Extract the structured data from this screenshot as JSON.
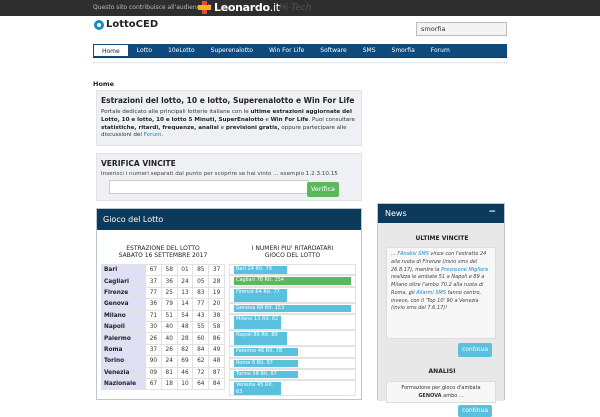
{
  "topbar": {
    "note": "Questo sito contribuisce all'audience di",
    "leo_name": "Leonardo",
    "leo_tld": ".it",
    "leo_sub": "Hi-Tech"
  },
  "site": {
    "name": "LottoCED"
  },
  "search": {
    "value": "smorfia"
  },
  "nav": {
    "items": [
      "Home",
      "Lotto",
      "10eLotto",
      "Superenalotto",
      "Win For Life",
      "Software",
      "SMS",
      "Smorfia",
      "Forum"
    ],
    "active": "Home"
  },
  "breadcrumb": "Home",
  "intro": {
    "title": "Estrazioni del lotto, 10 e lotto, Superenalotto e Win For Life",
    "t1": "Portale dedicato alle principali lotterie italiane con le ",
    "b1": "ultime estrazioni aggiornate del Lotto, 10 e lotto, 10 e lotto 5 Minuti, SuperEnalotto",
    "t2": " e ",
    "b2": "Win For Life",
    "t3": ". Puoi consultare ",
    "b3": "statistiche, ritardi, frequenze, analisi",
    "t4": " e ",
    "b4": "previsioni gratis,",
    "t5": " oppure partecipare alle discussioni del ",
    "link": "Forum",
    "t6": "."
  },
  "verify": {
    "title": "VERIFICA VINCITE",
    "sub": "Inserisci i numeri separati dal punto per scoprire se hai vinto ... esempio 1.2.3.10.15",
    "button": "Verifica"
  },
  "lotto": {
    "title": "Gioco del Lotto",
    "estr_title_1": "ESTRAZIONE DEL LOTTO",
    "estr_title_2": "SABATO 16 SETTEMBRE 2017",
    "rows": [
      {
        "city": "Bari",
        "n": [
          "67",
          "58",
          "01",
          "85",
          "37"
        ]
      },
      {
        "city": "Cagliari",
        "n": [
          "37",
          "36",
          "24",
          "05",
          "28"
        ]
      },
      {
        "city": "Firenze",
        "n": [
          "77",
          "25",
          "13",
          "83",
          "19"
        ]
      },
      {
        "city": "Genova",
        "n": [
          "36",
          "79",
          "14",
          "77",
          "20"
        ]
      },
      {
        "city": "Milano",
        "n": [
          "71",
          "51",
          "54",
          "43",
          "38"
        ]
      },
      {
        "city": "Napoli",
        "n": [
          "30",
          "40",
          "48",
          "55",
          "58"
        ]
      },
      {
        "city": "Palermo",
        "n": [
          "26",
          "40",
          "28",
          "60",
          "86"
        ]
      },
      {
        "city": "Roma",
        "n": [
          "37",
          "26",
          "82",
          "84",
          "49"
        ]
      },
      {
        "city": "Torino",
        "n": [
          "90",
          "24",
          "69",
          "62",
          "48"
        ]
      },
      {
        "city": "Venezia",
        "n": [
          "09",
          "81",
          "46",
          "72",
          "87"
        ]
      },
      {
        "city": "Nazionale",
        "n": [
          "67",
          "18",
          "10",
          "64",
          "84"
        ]
      }
    ],
    "rit_title_1": "I NUMERI PIU' RITARDATARI",
    "rit_title_2": "GIOCO DEL LOTTO",
    "ritardi": [
      {
        "label": "Bari 24 Rit. 79",
        "fill": 0.45
      },
      {
        "label": "Cagliari 78 Rit. 154",
        "fill": 1.0
      },
      {
        "label": "Firenze 64 Rit. 77",
        "fill": 0.45
      },
      {
        "label": "Genova 68 Rit. 153",
        "fill": 1.0
      },
      {
        "label": "Milano 13 Rit. 82",
        "fill": 0.4
      },
      {
        "label": "Napoli 86 Rit. 89",
        "fill": 0.45
      },
      {
        "label": "Palermo 46 Rit. 78",
        "fill": 0.55
      },
      {
        "label": "Roma 6 Rit. 97",
        "fill": 0.55
      },
      {
        "label": "Torino 58 Rit. 87",
        "fill": 0.55
      },
      {
        "label": "Venezia 45 Rit. 63",
        "fill": 0.4
      }
    ]
  },
  "news": {
    "title": "News",
    "toggle": "−",
    "ultime_title": "ULTIME VINCITE",
    "v_pre": "... l'",
    "v_link1": "Analisi SMS",
    "v_t1": " vince con l'estratto 24 alla ruota di Firenze (invio sms del 26.8.17), mentre la ",
    "v_link2": "Previsione Migliore",
    "v_t2": " realizza le ambate 51 a Napoli e 89 a Milano oltre l'ambo 70.2 alla ruota di Roma, gli ",
    "v_link3": "Allarmi SMS",
    "v_t3": " fanno centro, invece, con il 'Top 10' 90 a Venezia (invio sms del 7.6.17)!",
    "continua": "continua",
    "analisi_title": "ANALISI",
    "analisi_1": "Formazione per gioco d'ambata",
    "analisi_b": "GENOVA",
    "analisi_2": " ambo ..."
  }
}
